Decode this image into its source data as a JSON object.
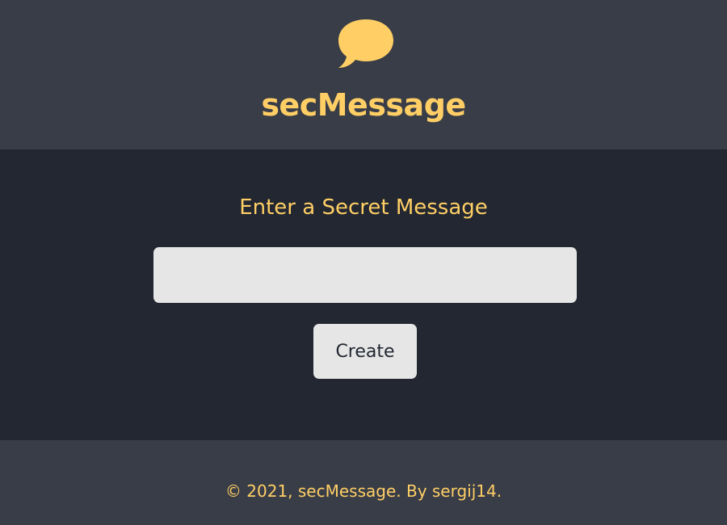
{
  "header": {
    "logo_icon": "speech-bubble-icon",
    "title": "secMessage"
  },
  "main": {
    "prompt": "Enter a Secret Message",
    "message_input": {
      "value": "",
      "placeholder": ""
    },
    "create_label": "Create"
  },
  "footer": {
    "text": "© 2021, secMessage. By sergij14."
  },
  "colors": {
    "accent": "#ffcf66",
    "header_bg": "#393d47",
    "main_bg": "#222731",
    "input_bg": "#e6e6e6"
  }
}
